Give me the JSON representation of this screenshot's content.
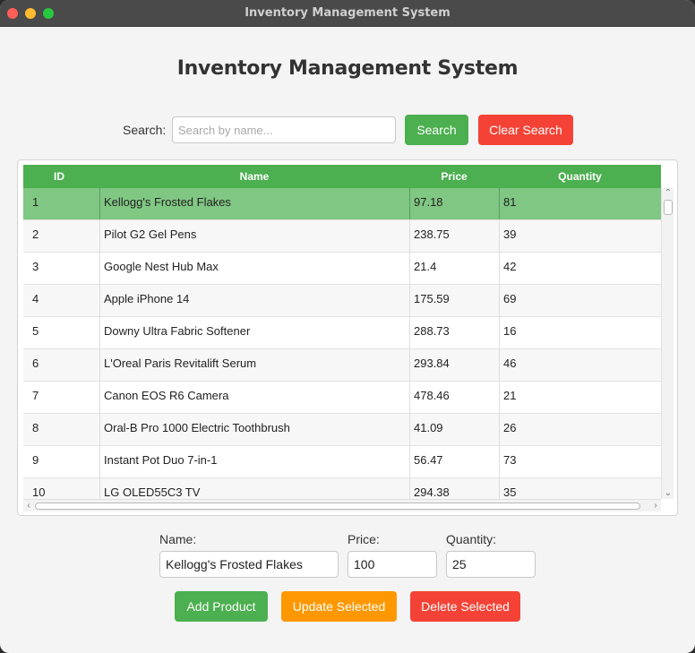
{
  "window": {
    "title": "Inventory Management System"
  },
  "app": {
    "heading": "Inventory Management System"
  },
  "search": {
    "label": "Search:",
    "placeholder": "Search by name...",
    "value": "",
    "search_button": "Search",
    "clear_button": "Clear Search"
  },
  "table": {
    "columns": [
      "ID",
      "Name",
      "Price",
      "Quantity"
    ],
    "selected_row": 1,
    "rows": [
      {
        "id": "1",
        "name": "Kellogg's Frosted Flakes",
        "price": "97.18",
        "quantity": "81"
      },
      {
        "id": "2",
        "name": "Pilot G2 Gel Pens",
        "price": "238.75",
        "quantity": "39"
      },
      {
        "id": "3",
        "name": "Google Nest Hub Max",
        "price": "21.4",
        "quantity": "42"
      },
      {
        "id": "4",
        "name": "Apple iPhone 14",
        "price": "175.59",
        "quantity": "69"
      },
      {
        "id": "5",
        "name": "Downy Ultra Fabric Softener",
        "price": "288.73",
        "quantity": "16"
      },
      {
        "id": "6",
        "name": "L'Oreal Paris Revitalift Serum",
        "price": "293.84",
        "quantity": "46"
      },
      {
        "id": "7",
        "name": "Canon EOS R6 Camera",
        "price": "478.46",
        "quantity": "21"
      },
      {
        "id": "8",
        "name": "Oral-B Pro 1000 Electric Toothbrush",
        "price": "41.09",
        "quantity": "26"
      },
      {
        "id": "9",
        "name": "Instant Pot Duo 7-in-1",
        "price": "56.47",
        "quantity": "73"
      },
      {
        "id": "10",
        "name": "LG OLED55C3 TV",
        "price": "294.38",
        "quantity": "35"
      }
    ]
  },
  "form": {
    "name_label": "Name:",
    "name_value": "Kellogg's Frosted Flakes",
    "price_label": "Price:",
    "price_value": "100",
    "quantity_label": "Quantity:",
    "quantity_value": "25"
  },
  "actions": {
    "add": "Add Product",
    "update": "Update Selected",
    "delete": "Delete Selected"
  },
  "colors": {
    "green": "#4caf50",
    "red": "#f44336",
    "orange": "#ff9800",
    "selected_row": "#80c783"
  }
}
